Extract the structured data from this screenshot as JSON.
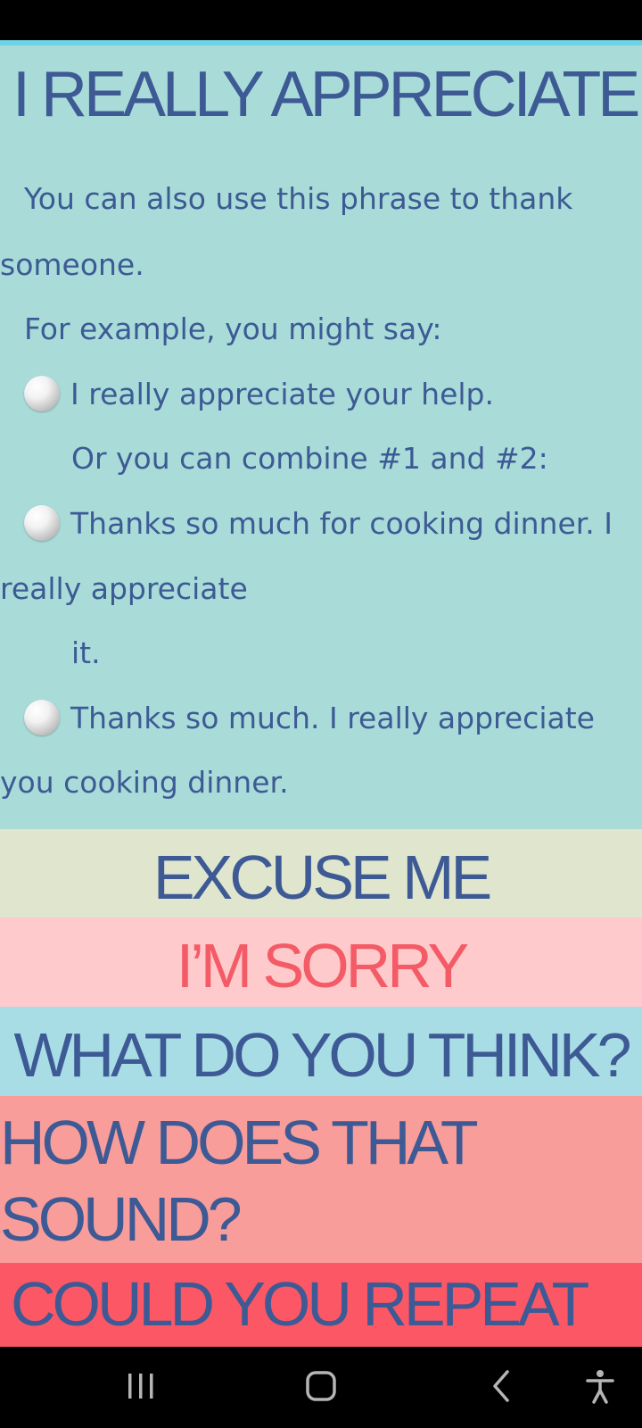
{
  "sections": {
    "appreciate": {
      "title": "I REALLY APPRECIATE...",
      "line1": "You can also use this phrase to thank",
      "line2": "someone.",
      "line3": "For example, you might say:",
      "example1": "I really appreciate your help.",
      "combine": "Or you can combine #1 and #2:",
      "example2_a": "Thanks so much for cooking dinner. I",
      "example2_b": "really appreciate",
      "example2_c": "it.",
      "example3_a": "Thanks so much. I really appreciate",
      "example3_b": "you cooking dinner."
    },
    "excuse_me": {
      "title": "EXCUSE ME"
    },
    "im_sorry": {
      "title": "I’M SORRY"
    },
    "what_think": {
      "title": "WHAT DO YOU THINK?"
    },
    "how_sound": {
      "title_line1": "HOW DOES THAT",
      "title_line2": "SOUND?"
    },
    "could_repeat": {
      "title": "COULD YOU REPEAT"
    }
  },
  "colors": {
    "text_blue": "#3d5a95",
    "sorry_red": "#f35b66",
    "appreciate_bg": "#a9dcd8",
    "excuse_bg": "#e0e5cd",
    "sorry_bg": "#ffcacb",
    "think_bg": "#a9dde6",
    "sound_bg": "#f99d9b",
    "repeat_bg": "#fc5765"
  },
  "nav": {
    "icons": [
      "recent-apps-icon",
      "home-icon",
      "back-icon",
      "accessibility-icon"
    ]
  }
}
